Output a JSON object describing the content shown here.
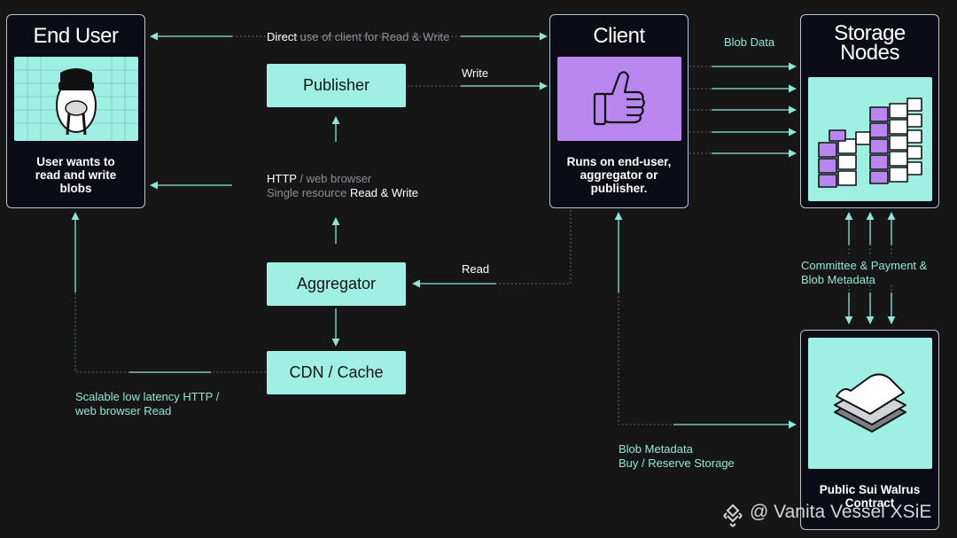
{
  "nodes": {
    "end_user": {
      "title": "End User",
      "desc": [
        "User wants to",
        "read and write",
        "blobs"
      ]
    },
    "client": {
      "title": "Client",
      "desc": [
        "Runs on end-user,",
        "aggregator or",
        "publisher."
      ]
    },
    "storage_nodes": {
      "title": [
        "Storage",
        "Nodes"
      ]
    },
    "publisher": {
      "label": "Publisher"
    },
    "aggregator": {
      "label": "Aggregator"
    },
    "cdn_cache": {
      "label": "CDN / Cache"
    },
    "sui_contract": {
      "title": [
        "Public Sui Walrus",
        "Contract"
      ]
    }
  },
  "edges": {
    "direct": {
      "hi": "Direct",
      "rest": " use of client for Read & Write"
    },
    "write": "Write",
    "http": {
      "line1_hi": "HTTP",
      "line1_rest": " / web browser",
      "line2_dim": "Single resource ",
      "line2_hi": "Read & Write"
    },
    "read": "Read",
    "scalable": [
      "Scalable low latency HTTP /",
      "web browser Read"
    ],
    "blob_data": "Blob Data",
    "committee": [
      "Committee & Payment &",
      "Blob Metadata"
    ],
    "blob_meta": [
      "Blob Metadata",
      "Buy / Reserve Storage"
    ]
  },
  "watermark": "@ Vanita Vessel XSiE",
  "colors": {
    "teal": "#9ff0e2",
    "purple": "#b886ee",
    "background": "#161616",
    "card": "#0c0c16"
  }
}
